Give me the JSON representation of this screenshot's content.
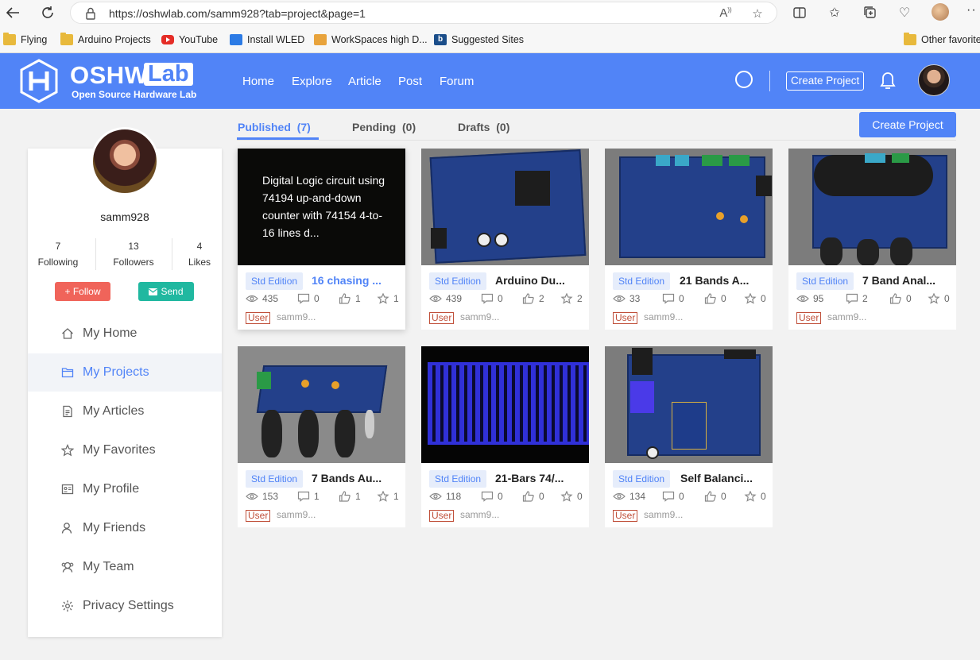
{
  "browser": {
    "url": "https://oshwlab.com/samm928?tab=project&page=1",
    "bookmarks": [
      {
        "label": "Flying",
        "icon": "folder-icon"
      },
      {
        "label": "Arduino Projects",
        "icon": "folder-icon"
      },
      {
        "label": "YouTube",
        "icon": "youtube-icon"
      },
      {
        "label": "Install WLED",
        "icon": "wled-icon"
      },
      {
        "label": "WorkSpaces high D...",
        "icon": "workspaces-icon"
      },
      {
        "label": "Suggested Sites",
        "icon": "bing-icon"
      },
      {
        "label": "Other favorite",
        "icon": "folder-icon"
      }
    ]
  },
  "header": {
    "logo_main": "OSHW",
    "logo_lab": "Lab",
    "logo_sub": "Open Source Hardware Lab",
    "nav": [
      "Home",
      "Explore",
      "Article",
      "Post",
      "Forum"
    ],
    "create_label": "Create Project"
  },
  "profile": {
    "username": "samm928",
    "stats": [
      {
        "value": "7",
        "label": "Following"
      },
      {
        "value": "13",
        "label": "Followers"
      },
      {
        "value": "4",
        "label": "Likes"
      }
    ],
    "follow_label": "+ Follow",
    "send_label": "Send"
  },
  "menu": [
    {
      "label": "My Home",
      "icon": "home-icon"
    },
    {
      "label": "My Projects",
      "icon": "folder-icon"
    },
    {
      "label": "My Articles",
      "icon": "document-icon"
    },
    {
      "label": "My Favorites",
      "icon": "star-icon"
    },
    {
      "label": "My Profile",
      "icon": "id-card-icon"
    },
    {
      "label": "My Friends",
      "icon": "user-icon"
    },
    {
      "label": "My Team",
      "icon": "team-icon"
    },
    {
      "label": "Privacy Settings",
      "icon": "gear-icon"
    }
  ],
  "tabs": [
    {
      "label": "Published",
      "count": "(7)"
    },
    {
      "label": "Pending",
      "count": "(0)"
    },
    {
      "label": "Drafts",
      "count": "(0)"
    }
  ],
  "create_button": "Create Project",
  "projects": [
    {
      "edition": "Std Edition",
      "title": "16 chasing ...",
      "views": "435",
      "comments": "0",
      "likes": "1",
      "stars": "1",
      "badge": "User",
      "owner": "samm9...",
      "hover_text": "Digital Logic circuit using 74194 up-and-down counter with 74154 4-to-16 lines d..."
    },
    {
      "edition": "Std Edition",
      "title": "Arduino Du...",
      "views": "439",
      "comments": "0",
      "likes": "2",
      "stars": "2",
      "badge": "User",
      "owner": "samm9..."
    },
    {
      "edition": "Std Edition",
      "title": "21 Bands A...",
      "views": "33",
      "comments": "0",
      "likes": "0",
      "stars": "0",
      "badge": "User",
      "owner": "samm9..."
    },
    {
      "edition": "Std Edition",
      "title": "7 Band Anal...",
      "views": "95",
      "comments": "2",
      "likes": "0",
      "stars": "0",
      "badge": "User",
      "owner": "samm9..."
    },
    {
      "edition": "Std Edition",
      "title": "7 Bands Au...",
      "views": "153",
      "comments": "1",
      "likes": "1",
      "stars": "1",
      "badge": "User",
      "owner": "samm9..."
    },
    {
      "edition": "Std Edition",
      "title": "21-Bars 74/...",
      "views": "118",
      "comments": "0",
      "likes": "0",
      "stars": "0",
      "badge": "User",
      "owner": "samm9..."
    },
    {
      "edition": "Std Edition",
      "title": "Self Balanci...",
      "views": "134",
      "comments": "0",
      "likes": "0",
      "stars": "0",
      "badge": "User",
      "owner": "samm9..."
    }
  ],
  "colors": {
    "brand": "#5184f7",
    "follow": "#f0645a",
    "send": "#20b8a0"
  }
}
